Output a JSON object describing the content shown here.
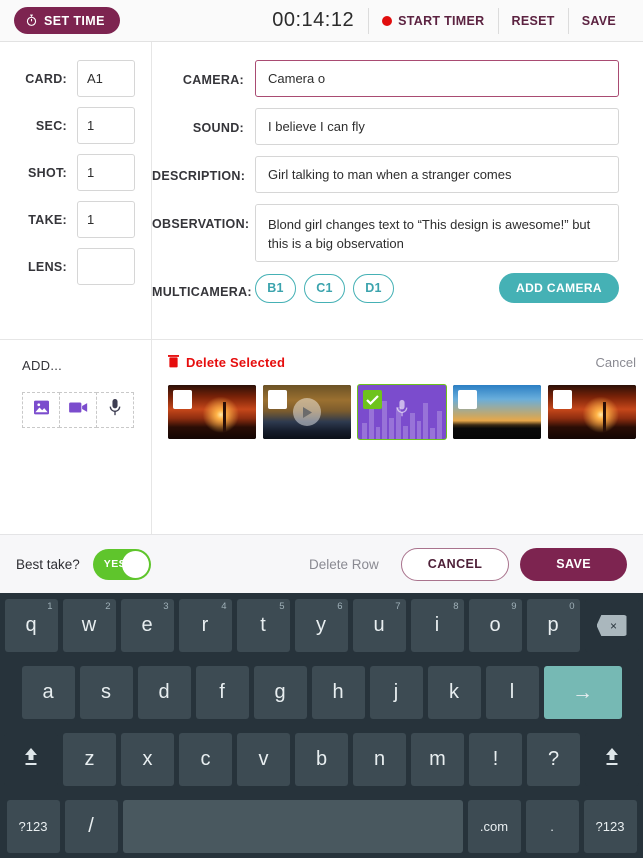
{
  "header": {
    "set_time_label": "SET TIME",
    "set_time_icon": "stopwatch-icon",
    "timer_value": "00:14:12",
    "start_timer_label": "START TIMER",
    "record_dot_icon": "record-dot-icon",
    "reset_label": "RESET",
    "save_label": "SAVE",
    "accent_color": "#7d2450"
  },
  "form": {
    "left_fields": [
      {
        "label": "CARD:",
        "value": "A1"
      },
      {
        "label": "SEC:",
        "value": "1"
      },
      {
        "label": "SHOT:",
        "value": "1"
      },
      {
        "label": "TAKE:",
        "value": "1"
      },
      {
        "label": "LENS:",
        "value": ""
      }
    ],
    "right_fields": {
      "camera": {
        "label": "CAMERA:",
        "value": "Camera o",
        "focused": true
      },
      "sound": {
        "label": "SOUND:",
        "value": "I believe I can fly"
      },
      "description": {
        "label": "DESCRIPTION:",
        "value": "Girl talking to man when a stranger comes"
      },
      "observation": {
        "label": "OBSERVATION:",
        "value": "Blond girl changes text to “This design is awesome!” but this is a big observation"
      }
    },
    "multicamera": {
      "label": "MULTICAMERA:",
      "chips": [
        "B1",
        "C1",
        "D1"
      ],
      "add_camera_label": "ADD CAMERA",
      "teal_color": "#45b1b5"
    }
  },
  "media": {
    "add_label": "ADD...",
    "add_icons": [
      "image-icon",
      "video-camera-icon",
      "microphone-icon"
    ],
    "delete_selected_label": "Delete Selected",
    "delete_icon": "trash-icon",
    "cancel_label": "Cancel",
    "delete_color": "#e60d0d",
    "thumbnails": [
      {
        "type": "image",
        "selected": false,
        "art": "sunset-a"
      },
      {
        "type": "video",
        "selected": false,
        "art": "sunset-b"
      },
      {
        "type": "audio",
        "selected": true,
        "art": "audio"
      },
      {
        "type": "image",
        "selected": false,
        "art": "sunset-c"
      },
      {
        "type": "image",
        "selected": false,
        "art": "sunset-a"
      }
    ]
  },
  "actions": {
    "best_take_label": "Best take?",
    "toggle_value": "YES",
    "toggle_on": true,
    "toggle_color": "#5fc52c",
    "delete_row_label": "Delete Row",
    "cancel_label": "CANCEL",
    "save_label": "SAVE"
  },
  "keyboard": {
    "row1": [
      {
        "key": "q",
        "num": "1"
      },
      {
        "key": "w",
        "num": "2"
      },
      {
        "key": "e",
        "num": "3"
      },
      {
        "key": "r",
        "num": "4"
      },
      {
        "key": "t",
        "num": "5"
      },
      {
        "key": "y",
        "num": "6"
      },
      {
        "key": "u",
        "num": "7"
      },
      {
        "key": "i",
        "num": "8"
      },
      {
        "key": "o",
        "num": "9"
      },
      {
        "key": "p",
        "num": "0"
      }
    ],
    "backspace_icon": "backspace-icon",
    "row2": [
      "a",
      "s",
      "d",
      "f",
      "g",
      "h",
      "j",
      "k",
      "l"
    ],
    "enter_label": "→",
    "row3": [
      "z",
      "x",
      "c",
      "v",
      "b",
      "n",
      "m",
      "!",
      "?"
    ],
    "shift_icon": "shift-icon",
    "row4": {
      "symbols_left": "?123",
      "slash": "/",
      "space": "",
      "dotcom": ".com",
      "period": ".",
      "symbols_right": "?123"
    }
  }
}
